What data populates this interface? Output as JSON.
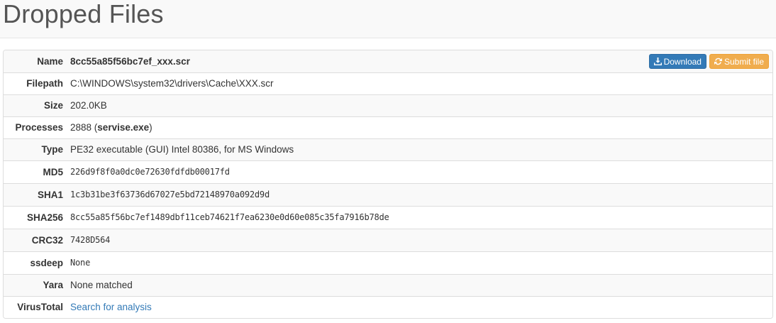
{
  "header": {
    "title": "Dropped Files"
  },
  "file": {
    "name_label": "Name",
    "name": "8cc55a85f56bc7ef_xxx.scr",
    "filepath_label": "Filepath",
    "filepath": "C:\\WINDOWS\\system32\\drivers\\Cache\\XXX.scr",
    "size_label": "Size",
    "size": "202.0KB",
    "processes_label": "Processes",
    "process_pid": "2888",
    "process_name": "servise.exe",
    "type_label": "Type",
    "type": "PE32 executable (GUI) Intel 80386, for MS Windows",
    "md5_label": "MD5",
    "md5": "226d9f8f0a0dc0e72630fdfdb00017fd",
    "sha1_label": "SHA1",
    "sha1": "1c3b31be3f63736d67027e5bd72148970a092d9d",
    "sha256_label": "SHA256",
    "sha256": "8cc55a85f56bc7ef1489dbf11ceb74621f7ea6230e0d60e085c35fa7916b78de",
    "crc32_label": "CRC32",
    "crc32": "7428D564",
    "ssdeep_label": "ssdeep",
    "ssdeep": "None",
    "yara_label": "Yara",
    "yara": "None matched",
    "virustotal_label": "VirusTotal",
    "virustotal_link": "Search for analysis"
  },
  "buttons": {
    "download_label": "Download",
    "download_icon": "download-icon",
    "submit_label": "Submit file",
    "submit_icon": "refresh-icon"
  },
  "colors": {
    "primary": "#337ab7",
    "warning": "#f0ad4e",
    "link": "#337ab7"
  }
}
